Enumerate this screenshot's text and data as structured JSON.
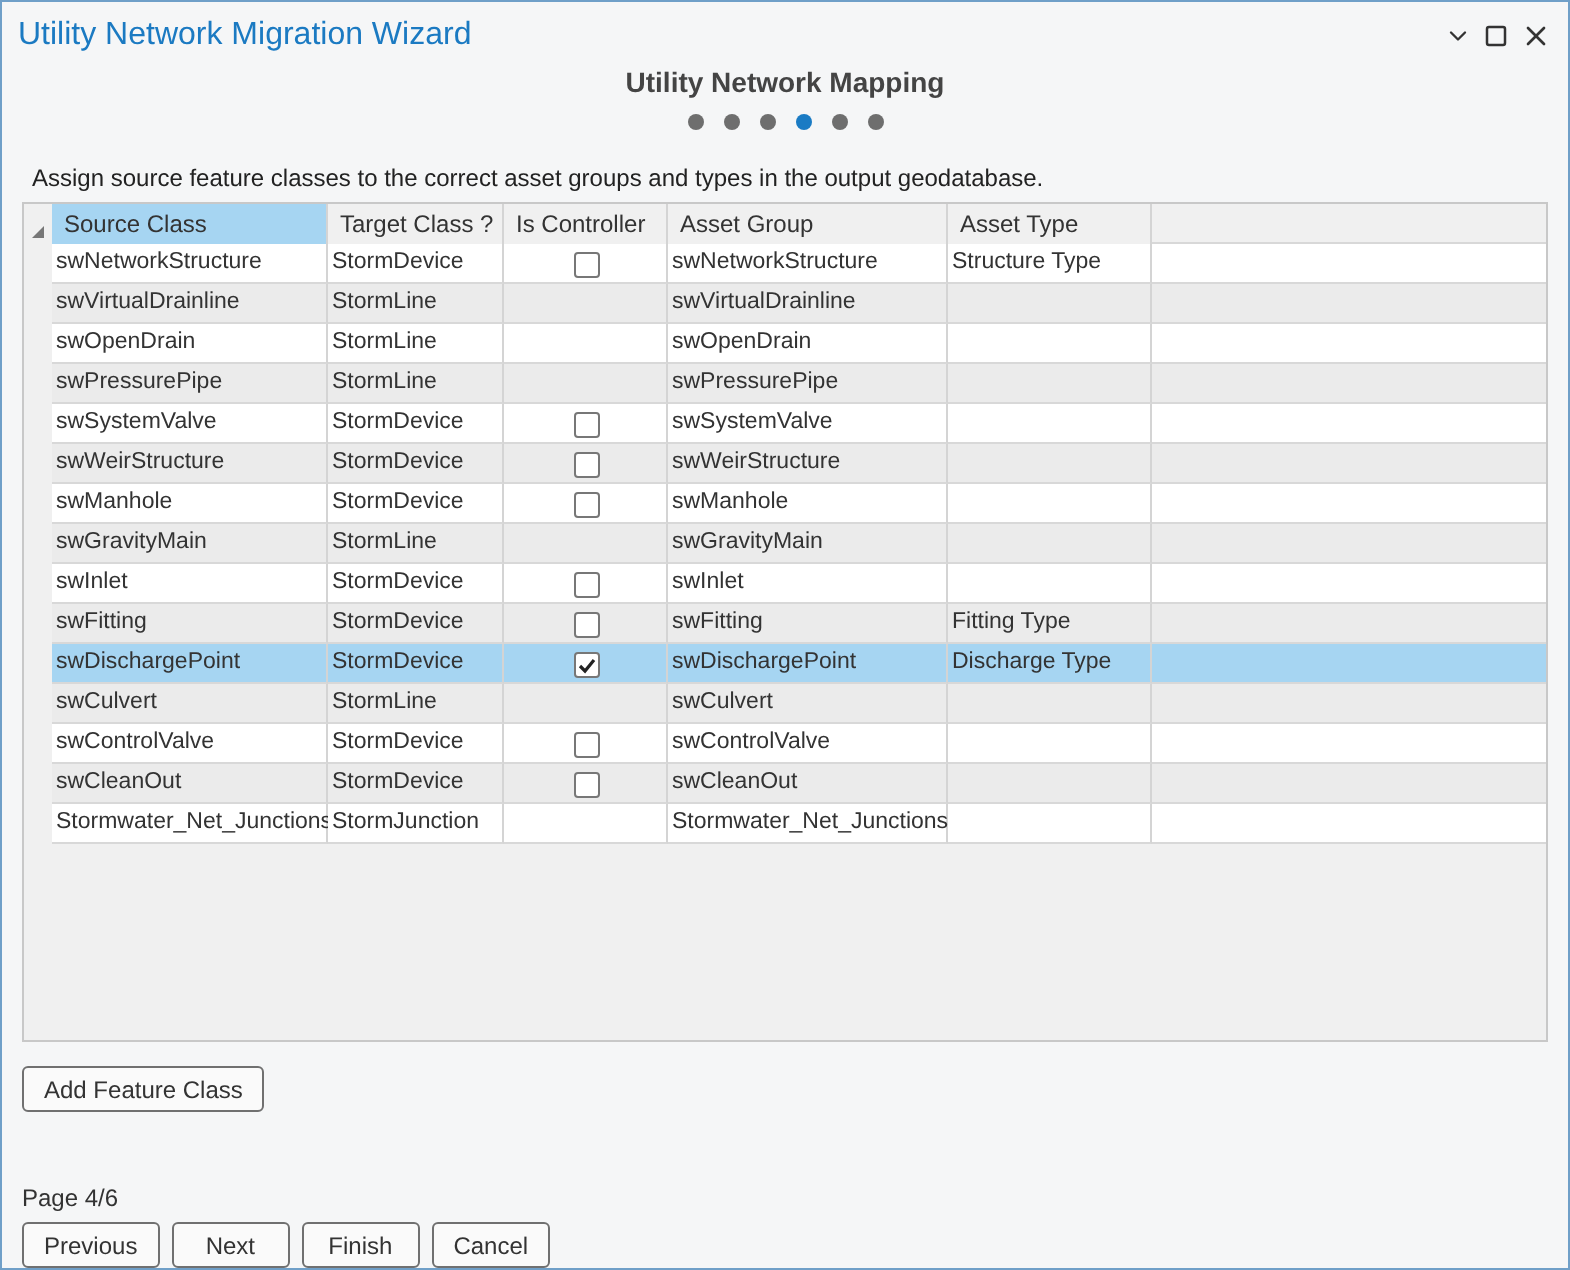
{
  "window": {
    "title": "Utility Network Migration Wizard"
  },
  "page_title": "Utility Network Mapping",
  "steps": [
    {
      "selected": false
    },
    {
      "selected": false
    },
    {
      "selected": false
    },
    {
      "selected": true
    },
    {
      "selected": false
    },
    {
      "selected": false
    }
  ],
  "instructions": "Assign source feature classes to the correct asset groups and types in the output geodatabase.",
  "table": {
    "columns": [
      {
        "label": "Source Class",
        "selected": true
      },
      {
        "label": "Target Class ?",
        "selected": false
      },
      {
        "label": "Is Controller",
        "selected": false
      },
      {
        "label": "Asset Group",
        "selected": false
      },
      {
        "label": "Asset Type",
        "selected": false
      }
    ],
    "rows": [
      {
        "source": "swNetworkStructure",
        "target": "StormDevice",
        "checked": false,
        "group": "swNetworkStructure",
        "type": "Structure Type",
        "selected": false
      },
      {
        "source": "swVirtualDrainline",
        "target": "StormLine",
        "group": "swVirtualDrainline",
        "selected": false
      },
      {
        "source": "swOpenDrain",
        "target": "StormLine",
        "group": "swOpenDrain",
        "selected": false
      },
      {
        "source": "swPressurePipe",
        "target": "StormLine",
        "group": "swPressurePipe",
        "selected": false
      },
      {
        "source": "swSystemValve",
        "target": "StormDevice",
        "checked": false,
        "group": "swSystemValve",
        "selected": false
      },
      {
        "source": "swWeirStructure",
        "target": "StormDevice",
        "checked": false,
        "group": "swWeirStructure",
        "selected": false
      },
      {
        "source": "swManhole",
        "target": "StormDevice",
        "checked": false,
        "group": "swManhole",
        "selected": false
      },
      {
        "source": "swGravityMain",
        "target": "StormLine",
        "group": "swGravityMain",
        "selected": false
      },
      {
        "source": "swInlet",
        "target": "StormDevice",
        "checked": false,
        "group": "swInlet",
        "selected": false
      },
      {
        "source": "swFitting",
        "target": "StormDevice",
        "checked": false,
        "group": "swFitting",
        "type": "Fitting Type",
        "selected": false
      },
      {
        "source": "swDischargePoint",
        "target": "StormDevice",
        "checked": true,
        "group": "swDischargePoint",
        "type": "Discharge Type",
        "selected": true
      },
      {
        "source": "swCulvert",
        "target": "StormLine",
        "group": "swCulvert",
        "selected": false
      },
      {
        "source": "swControlValve",
        "target": "StormDevice",
        "checked": false,
        "group": "swControlValve",
        "selected": false
      },
      {
        "source": "swCleanOut",
        "target": "StormDevice",
        "checked": false,
        "group": "swCleanOut",
        "selected": false
      },
      {
        "source": "Stormwater_Net_Junctions",
        "target": "StormJunction",
        "group": "Stormwater_Net_Junctions",
        "selected": false
      }
    ]
  },
  "add_button": "Add Feature Class",
  "page_indicator": "Page 4/6",
  "buttons": [
    "Previous",
    "Next",
    "Finish",
    "Cancel"
  ]
}
